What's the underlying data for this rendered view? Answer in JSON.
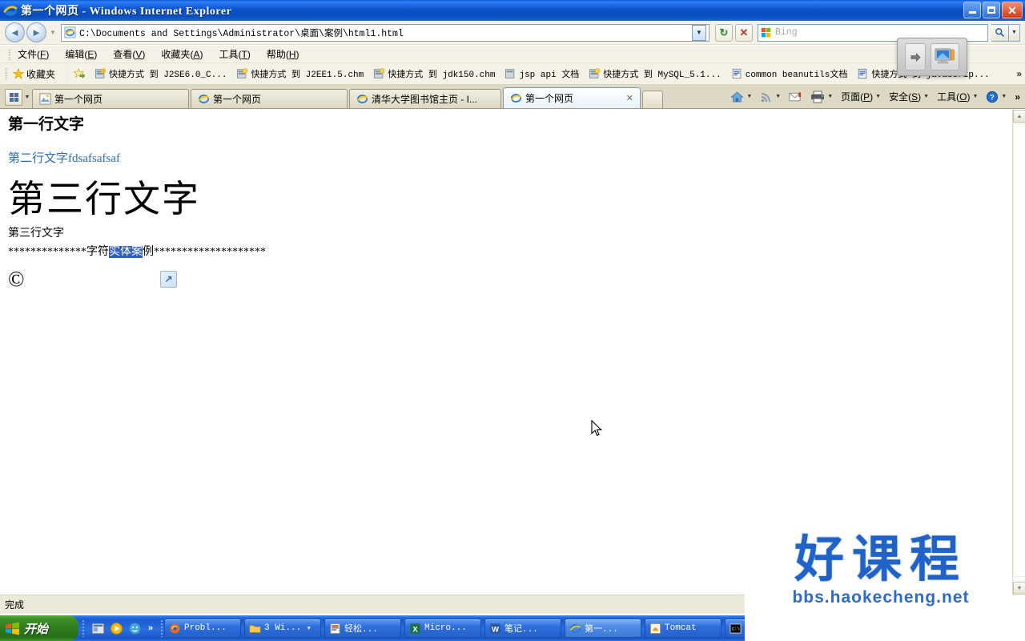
{
  "window": {
    "title": "第一个网页 - Windows Internet Explorer",
    "minimize_label": "最小化",
    "maximize_label": "最大化",
    "close_label": "关闭"
  },
  "navigation": {
    "back_glyph": "◄",
    "forward_glyph": "►",
    "recent_dropdown_glyph": "▼",
    "address_value": "C:\\Documents and Settings\\Administrator\\桌面\\案例\\html1.html",
    "address_dropdown_glyph": "▼",
    "refresh_glyph": "↻",
    "stop_glyph": "✕",
    "search_placeholder": "Bing",
    "search_go_glyph": "⌕",
    "search_dropdown_glyph": "▼"
  },
  "menubar": {
    "items": [
      {
        "label": "文件",
        "accel": "F"
      },
      {
        "label": "编辑",
        "accel": "E"
      },
      {
        "label": "查看",
        "accel": "V"
      },
      {
        "label": "收藏夹",
        "accel": "A"
      },
      {
        "label": "工具",
        "accel": "T"
      },
      {
        "label": "帮助",
        "accel": "H"
      }
    ]
  },
  "favorites_bar": {
    "favorites_label": "收藏夹",
    "add_icon": "add-favorite-icon",
    "items": [
      {
        "label": "快捷方式 到 J2SE6.0_C...",
        "icon": "chm-shortcut-icon"
      },
      {
        "label": "快捷方式 到 J2EE1.5.chm",
        "icon": "chm-shortcut-icon"
      },
      {
        "label": "快捷方式 到 jdk150.chm",
        "icon": "chm-shortcut-icon"
      },
      {
        "label": "jsp api 文档",
        "icon": "chm-shortcut-icon"
      },
      {
        "label": "快捷方式 到 MySQL_5.1...",
        "icon": "chm-shortcut-icon"
      },
      {
        "label": "common beanutils文档",
        "icon": "doc-shortcut-icon"
      },
      {
        "label": "快捷方式 到 javascrip...",
        "icon": "doc-shortcut-icon"
      }
    ],
    "overflow_glyph": "»"
  },
  "tabs": {
    "quick_tabs_label": "快速导航选项卡",
    "tab_list_glyph": "▼",
    "items": [
      {
        "label": "第一个网页",
        "active": false,
        "icon": "page-icon"
      },
      {
        "label": "第一个网页",
        "active": false,
        "icon": "ie-icon"
      },
      {
        "label": "清华大学图书馆主页 - I...",
        "active": false,
        "icon": "ie-icon"
      },
      {
        "label": "第一个网页",
        "active": true,
        "icon": "ie-icon",
        "close_glyph": "✕"
      }
    ],
    "new_tab_label": "新选项卡"
  },
  "command_bar": {
    "items": [
      {
        "label": "",
        "icon": "home-icon",
        "caret": "▼"
      },
      {
        "label": "",
        "icon": "feeds-icon",
        "caret": "▼"
      },
      {
        "label": "",
        "icon": "mail-icon",
        "caret": ""
      },
      {
        "label": "",
        "icon": "print-icon",
        "caret": "▼"
      },
      {
        "label": "页面",
        "icon": "",
        "accel": "P",
        "caret": "▼"
      },
      {
        "label": "安全",
        "icon": "",
        "accel": "S",
        "caret": "▼"
      },
      {
        "label": "工具",
        "icon": "",
        "accel": "O",
        "caret": "▼"
      },
      {
        "label": "",
        "icon": "help-icon",
        "caret": "▼"
      }
    ],
    "overflow_glyph": "»"
  },
  "page_content": {
    "heading_first": "第一行文字",
    "link_second_cn": "第二行文字",
    "link_second_en": "fdsafsafsaf",
    "heading_third_big": "第三行文字",
    "paragraph_third": "第三行文字",
    "stars_before": "**************",
    "entity_label_plain_a": "字符",
    "entity_label_selected": "实体案",
    "entity_label_plain_b": "例",
    "stars_after": "********************",
    "copyright_symbol": "©",
    "broken_image_alt": "broken-image-placeholder"
  },
  "scrollbar": {
    "up_glyph": "▲",
    "down_glyph": "▼"
  },
  "statusbar": {
    "text": "完成"
  },
  "float_toolbar": {
    "arrow_glyph": "➔",
    "monitor_icon": "monitor-icon"
  },
  "taskbar": {
    "start_label": "开始",
    "quick_launch": [
      {
        "icon": "show-desktop-icon"
      },
      {
        "icon": "media-player-icon"
      },
      {
        "icon": "messenger-icon"
      }
    ],
    "quick_launch_overflow": "»",
    "tasks": [
      {
        "label": "Probl...",
        "icon": "firefox-icon",
        "active": false
      },
      {
        "label": "3 Wi...",
        "icon": "folder-icon",
        "active": false,
        "caret": "▼"
      },
      {
        "label": "轻松...",
        "icon": "app-icon",
        "active": false
      },
      {
        "label": "Micro...",
        "icon": "excel-icon",
        "active": false
      },
      {
        "label": "笔记...",
        "icon": "word-icon",
        "active": false
      },
      {
        "label": "第一...",
        "icon": "ie-icon",
        "active": true
      },
      {
        "label": "Tomcat",
        "icon": "tomcat-icon",
        "active": false
      },
      {
        "label": "C:\\",
        "icon": "console-icon",
        "active": false
      }
    ]
  },
  "watermark": {
    "cn_text": "好课程",
    "url_text": "bbs.haokecheng.net",
    "color": "#1f63c8"
  },
  "colors": {
    "title_bar_blue": "#0b52c8",
    "chrome_beige": "#f4f2e6",
    "tab_strip": "#ded9c4",
    "taskbar_blue": "#2468d8",
    "start_green": "#3d8c28",
    "link_blue": "#2f6eb5",
    "selection_blue": "#2f5fc4"
  }
}
